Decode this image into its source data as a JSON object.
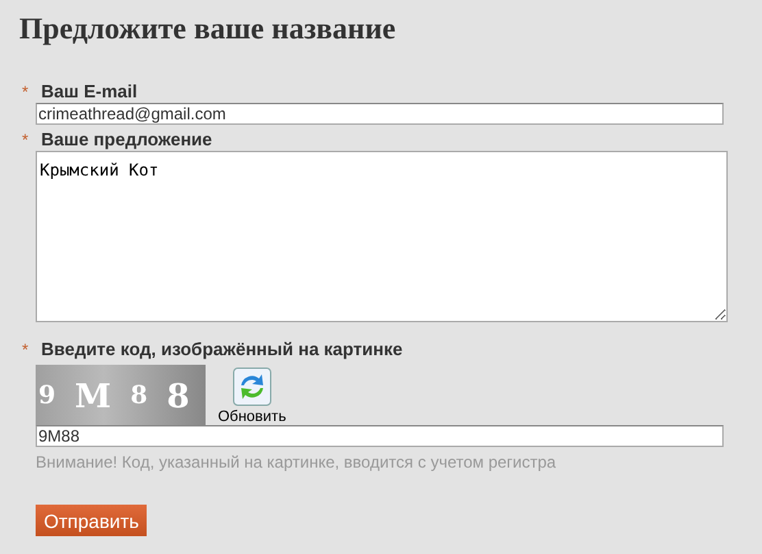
{
  "title": "Предложите ваше название",
  "fields": [
    {
      "kind": "input",
      "label": "Ваш E-mail",
      "required_mark": "*",
      "value": "crimeathread@gmail.com"
    },
    {
      "kind": "textarea",
      "label": "Ваше предложение",
      "required_mark": "*",
      "value": "Крымский Кот"
    }
  ],
  "captcha": {
    "label": "Введите код, изображённый на картинке",
    "required_mark": "*",
    "code_chars": [
      "9",
      "M",
      "8",
      "8"
    ],
    "refresh_label": "Обновить",
    "value": "9M88",
    "hint": "Внимание! Код, указанный на картинке, вводится с учетом регистра"
  },
  "submit": "Отправить"
}
